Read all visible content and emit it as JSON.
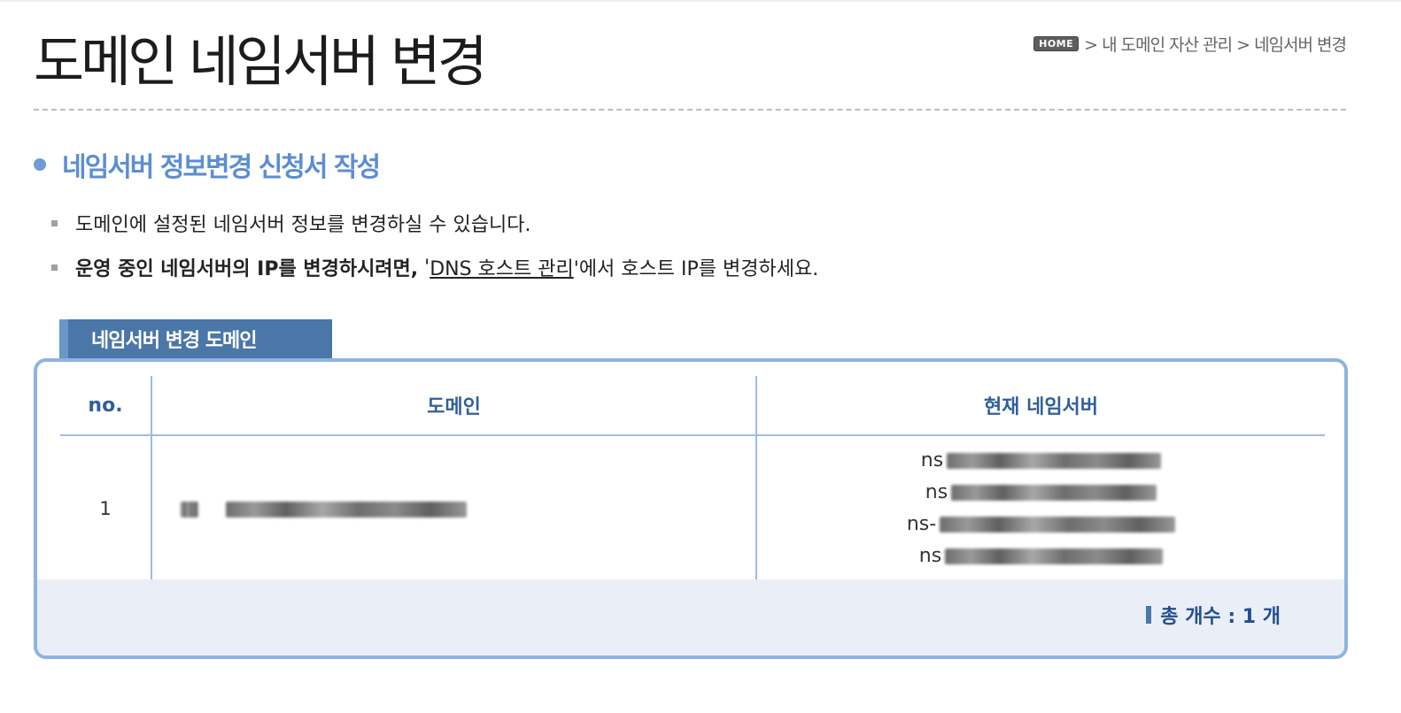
{
  "page": {
    "title": "도메인 네임서버 변경"
  },
  "breadcrumb": {
    "home": "HOME",
    "path": "> 내 도메인 자산 관리 > 네임서버 변경"
  },
  "section": {
    "title": "네임서버 정보변경 신청서 작성"
  },
  "notes": {
    "line1": "도메인에 설정된 네임서버 정보를 변경하실 수 있습니다.",
    "line2_bold": "운영 중인 네임서버의 IP를 변경하시려면,",
    "line2_quote_open": " '",
    "line2_link": "DNS 호스트 관리",
    "line2_rest": "'에서 호스트 IP를 변경하세요."
  },
  "panel": {
    "tab_label": "네임서버 변경 도메인",
    "headers": {
      "no": "no.",
      "domain": "도메인",
      "nameserver": "현재 네임서버"
    },
    "rows": [
      {
        "no": "1",
        "domain": "",
        "nameservers": [
          "ns",
          "ns",
          "ns-",
          "ns"
        ]
      }
    ],
    "total": "총 개수 : 1 개"
  }
}
